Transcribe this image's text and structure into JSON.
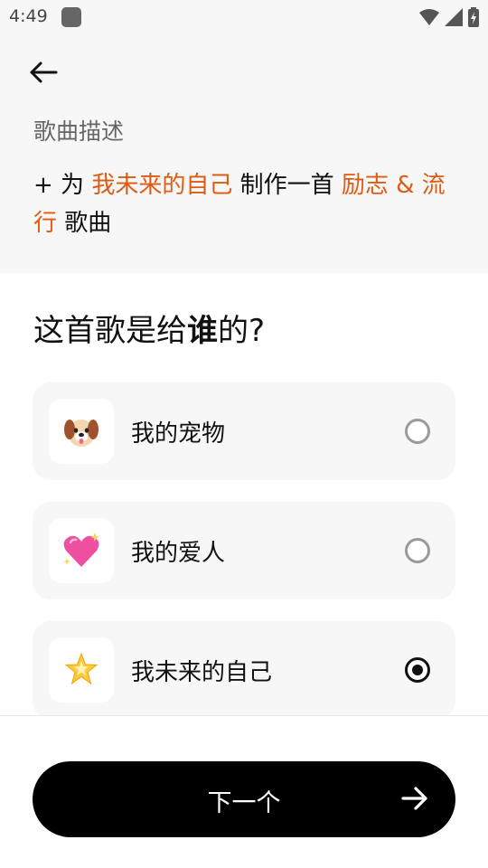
{
  "status_bar": {
    "time": "4:49"
  },
  "header": {
    "back_icon": "arrow-left-icon",
    "description_label": "歌曲描述",
    "description": {
      "prefix": "+ 为 ",
      "recipient": "我未来的自己",
      "middle": " 制作一首 ",
      "genre_line1": "励志 & 流",
      "genre_line2": "行",
      "suffix": " 歌曲"
    }
  },
  "question": {
    "before": "这首歌是给",
    "emphasis": "谁",
    "after": "的?"
  },
  "options": [
    {
      "emoji": "🐶",
      "emoji_name": "dog-face-icon",
      "label": "我的宠物",
      "selected": false
    },
    {
      "emoji": "💖",
      "emoji_name": "sparkling-heart-icon",
      "label": "我的爱人",
      "selected": false
    },
    {
      "emoji": "🌟",
      "emoji_name": "glowing-star-icon",
      "label": "我未来的自己",
      "selected": true
    }
  ],
  "footer": {
    "next_label": "下一个",
    "next_icon": "arrow-right-icon"
  },
  "colors": {
    "highlight": "#e05a12",
    "button_bg": "#000000",
    "card_bg": "#f7f7f7"
  }
}
